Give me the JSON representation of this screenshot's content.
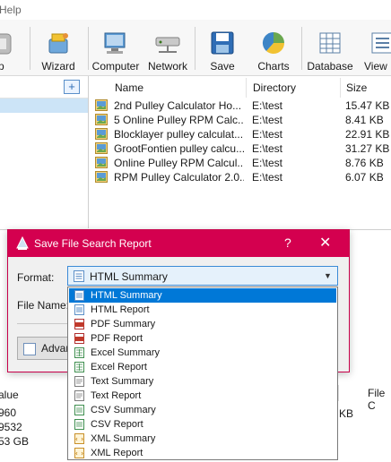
{
  "menu": {
    "partial_item": "Help"
  },
  "toolbar": {
    "items": [
      {
        "label": "top"
      },
      {
        "label": "Wizard"
      },
      {
        "label": "Computer"
      },
      {
        "label": "Network"
      },
      {
        "label": "Save"
      },
      {
        "label": "Charts"
      },
      {
        "label": "Database"
      },
      {
        "label": "View"
      }
    ]
  },
  "filelist": {
    "columns": [
      "Name",
      "Directory",
      "Size"
    ],
    "rows": [
      {
        "name": "2nd Pulley Calculator Ho...",
        "dir": "E:\\test",
        "size": "15.47 KB"
      },
      {
        "name": "5 Online Pulley RPM Calc...",
        "dir": "E:\\test",
        "size": "8.41 KB"
      },
      {
        "name": "Blocklayer pulley calculat...",
        "dir": "E:\\test",
        "size": "22.91 KB"
      },
      {
        "name": "GrootFontien pulley calcu...",
        "dir": "E:\\test",
        "size": "31.27 KB"
      },
      {
        "name": "Online Pulley RPM Calcul...",
        "dir": "E:\\test",
        "size": "8.76 KB"
      },
      {
        "name": "RPM Pulley Calculator 2.0....",
        "dir": "E:\\test",
        "size": "6.07 KB"
      }
    ]
  },
  "bottom": {
    "header_left": "alue",
    "values": [
      "960",
      "9532",
      "53 GB"
    ],
    "kb": "KB",
    "file_col": "File C"
  },
  "dialog": {
    "title": "Save File Search Report",
    "help": "?",
    "close": "✕",
    "format_label": "Format:",
    "format_value": "HTML Summary",
    "filename_label": "File Name:",
    "filename_value": "",
    "advanced_label": "Advan"
  },
  "dropdown": {
    "options": [
      {
        "label": "HTML Summary",
        "icon": "html",
        "selected": true
      },
      {
        "label": "HTML Report",
        "icon": "html"
      },
      {
        "label": "PDF Summary",
        "icon": "pdf"
      },
      {
        "label": "PDF Report",
        "icon": "pdf"
      },
      {
        "label": "Excel Summary",
        "icon": "excel"
      },
      {
        "label": "Excel Report",
        "icon": "excel"
      },
      {
        "label": "Text Summary",
        "icon": "text"
      },
      {
        "label": "Text Report",
        "icon": "text"
      },
      {
        "label": "CSV Summary",
        "icon": "csv"
      },
      {
        "label": "CSV Report",
        "icon": "csv"
      },
      {
        "label": "XML Summary",
        "icon": "xml"
      },
      {
        "label": "XML Report",
        "icon": "xml"
      }
    ]
  },
  "colors": {
    "accent": "#d4004f",
    "selection": "#0078d7"
  }
}
